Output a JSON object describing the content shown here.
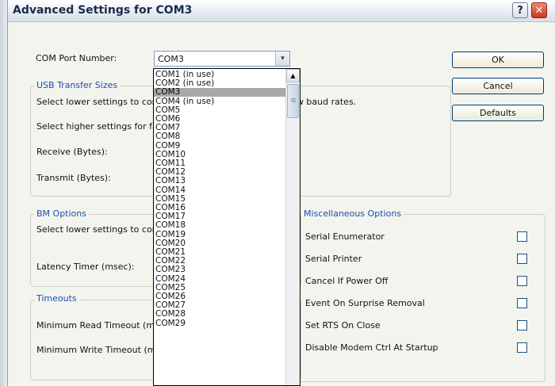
{
  "window": {
    "title": "Advanced Settings for COM3",
    "help_glyph": "?",
    "close_glyph": "✕"
  },
  "com_port": {
    "label": "COM Port Number:",
    "value": "COM3",
    "arrow": "▾"
  },
  "usb": {
    "legend": "USB Transfer Sizes",
    "lower_text": "Select lower settings to correct performance problems at low baud rates.",
    "higher_text": "Select higher settings for faster performance.",
    "receive_label": "Receive (Bytes):",
    "transmit_label": "Transmit (Bytes):"
  },
  "bm": {
    "legend": "BM Options",
    "lower_text": "Select lower settings to correct response problems.",
    "latency_label": "Latency Timer (msec):"
  },
  "timeouts": {
    "legend": "Timeouts",
    "min_read_label": "Minimum Read Timeout (msec):",
    "min_write_label": "Minimum Write Timeout (msec):"
  },
  "buttons": {
    "ok": "OK",
    "cancel": "Cancel",
    "defaults": "Defaults"
  },
  "misc": {
    "legend": "Miscellaneous Options",
    "options": [
      {
        "label": "Serial Enumerator",
        "checked": false
      },
      {
        "label": "Serial Printer",
        "checked": false
      },
      {
        "label": "Cancel If Power Off",
        "checked": false
      },
      {
        "label": "Event On Surprise Removal",
        "checked": false
      },
      {
        "label": "Set RTS On Close",
        "checked": false
      },
      {
        "label": "Disable Modem Ctrl At Startup",
        "checked": false
      }
    ]
  },
  "dropdown": {
    "selected_index": 2,
    "options": [
      "COM1 (in use)",
      "COM2 (in use)",
      "COM3",
      "COM4 (in use)",
      "COM5",
      "COM6",
      "COM7",
      "COM8",
      "COM9",
      "COM10",
      "COM11",
      "COM12",
      "COM13",
      "COM14",
      "COM15",
      "COM16",
      "COM17",
      "COM18",
      "COM19",
      "COM20",
      "COM21",
      "COM22",
      "COM23",
      "COM24",
      "COM25",
      "COM26",
      "COM27",
      "COM28",
      "COM29"
    ]
  },
  "colors": {
    "legend": "#1b4fa7",
    "selected_option": "#a8a8a8",
    "dialog_bg": "#f4f4ef"
  }
}
